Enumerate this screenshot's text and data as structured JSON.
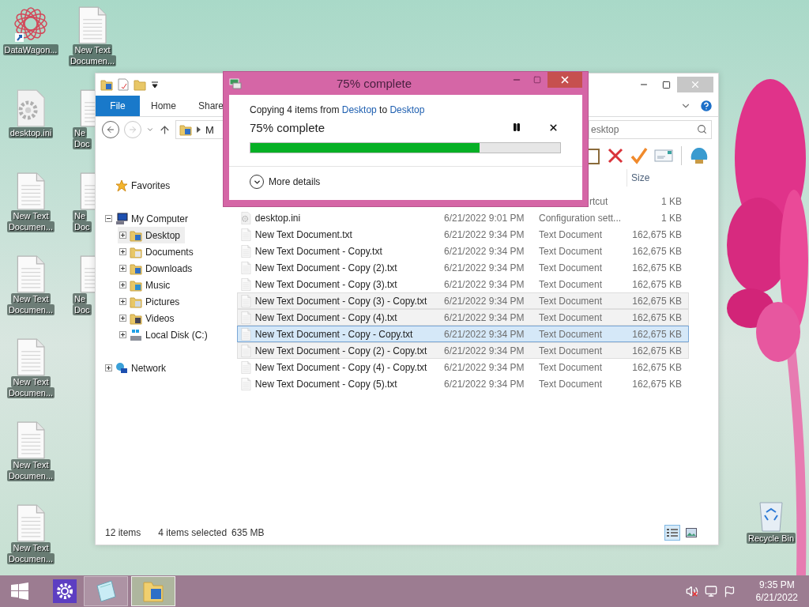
{
  "desktop": {
    "columns": [
      [
        {
          "kind": "app",
          "lines": [
            "DataWagon..."
          ]
        },
        {
          "kind": "config",
          "lines": [
            "desktop.ini"
          ]
        },
        {
          "kind": "doc",
          "lines": [
            "New Text",
            "Documen..."
          ]
        },
        {
          "kind": "doc",
          "lines": [
            "New Text",
            "Documen..."
          ]
        },
        {
          "kind": "doc",
          "lines": [
            "New Text",
            "Documen..."
          ]
        },
        {
          "kind": "doc",
          "lines": [
            "New Text",
            "Documen..."
          ]
        },
        {
          "kind": "doc",
          "lines": [
            "New Text",
            "Documen..."
          ]
        }
      ],
      [
        {
          "kind": "doc",
          "lines": [
            "New Text",
            "Documen..."
          ]
        },
        {
          "kind": "partial",
          "lines": [
            "Ne",
            "Doc"
          ]
        },
        {
          "kind": "partial",
          "lines": [
            "Ne",
            "Doc"
          ]
        },
        {
          "kind": "partial",
          "lines": [
            "Ne",
            "Doc"
          ]
        }
      ]
    ],
    "recycle_bin": {
      "label": "Recycle Bin"
    }
  },
  "explorer": {
    "ribbon_tabs": [
      {
        "label": "File",
        "selected": true
      },
      {
        "label": "Home",
        "selected": false
      },
      {
        "label": "Share",
        "selected": false
      }
    ],
    "address": {
      "path": "M"
    },
    "search": {
      "placeholder": "esktop"
    },
    "nav": [
      {
        "label": "Favorites",
        "kind": "favorites",
        "selected": false
      },
      {
        "label": "My Computer",
        "kind": "computer",
        "selected": false,
        "expanded": true,
        "children": [
          {
            "label": "Desktop",
            "kind": "desktop",
            "selected": true,
            "expanded": false
          },
          {
            "label": "Documents",
            "kind": "documents",
            "selected": false,
            "expanded": false
          },
          {
            "label": "Downloads",
            "kind": "downloads",
            "selected": false,
            "expanded": false
          },
          {
            "label": "Music",
            "kind": "music",
            "selected": false,
            "expanded": false
          },
          {
            "label": "Pictures",
            "kind": "pictures",
            "selected": false,
            "expanded": false
          },
          {
            "label": "Videos",
            "kind": "videos",
            "selected": false,
            "expanded": false
          },
          {
            "label": "Local Disk (C:)",
            "kind": "disk",
            "selected": false,
            "expanded": false
          }
        ]
      },
      {
        "label": "Network",
        "kind": "network",
        "selected": false,
        "expanded": false
      }
    ],
    "columns": [
      "Size"
    ],
    "rows": [
      {
        "kind": "partial",
        "type": "rtcut",
        "size": "1 KB",
        "selected": false,
        "focused": false
      },
      {
        "kind": "config",
        "name": "desktop.ini",
        "date": "6/21/2022 9:01 PM",
        "type": "Configuration sett...",
        "size": "1 KB",
        "selected": false,
        "focused": false
      },
      {
        "kind": "text",
        "name": "New Text Document.txt",
        "date": "6/21/2022 9:34 PM",
        "type": "Text Document",
        "size": "162,675 KB",
        "selected": false,
        "focused": false
      },
      {
        "kind": "text",
        "name": "New Text Document - Copy.txt",
        "date": "6/21/2022 9:34 PM",
        "type": "Text Document",
        "size": "162,675 KB",
        "selected": false,
        "focused": false
      },
      {
        "kind": "text",
        "name": "New Text Document - Copy (2).txt",
        "date": "6/21/2022 9:34 PM",
        "type": "Text Document",
        "size": "162,675 KB",
        "selected": false,
        "focused": false
      },
      {
        "kind": "text",
        "name": "New Text Document - Copy (3).txt",
        "date": "6/21/2022 9:34 PM",
        "type": "Text Document",
        "size": "162,675 KB",
        "selected": false,
        "focused": false
      },
      {
        "kind": "text",
        "name": "New Text Document - Copy (3) - Copy.txt",
        "date": "6/21/2022 9:34 PM",
        "type": "Text Document",
        "size": "162,675 KB",
        "selected": true,
        "focused": false
      },
      {
        "kind": "text",
        "name": "New Text Document - Copy (4).txt",
        "date": "6/21/2022 9:34 PM",
        "type": "Text Document",
        "size": "162,675 KB",
        "selected": true,
        "focused": false
      },
      {
        "kind": "text",
        "name": "New Text Document - Copy - Copy.txt",
        "date": "6/21/2022 9:34 PM",
        "type": "Text Document",
        "size": "162,675 KB",
        "selected": true,
        "focused": true
      },
      {
        "kind": "text",
        "name": "New Text Document - Copy (2) - Copy.txt",
        "date": "6/21/2022 9:34 PM",
        "type": "Text Document",
        "size": "162,675 KB",
        "selected": true,
        "focused": false
      },
      {
        "kind": "text",
        "name": "New Text Document - Copy (4) - Copy.txt",
        "date": "6/21/2022 9:34 PM",
        "type": "Text Document",
        "size": "162,675 KB",
        "selected": false,
        "focused": false
      },
      {
        "kind": "text",
        "name": "New Text Document - Copy (5).txt",
        "date": "6/21/2022 9:34 PM",
        "type": "Text Document",
        "size": "162,675 KB",
        "selected": false,
        "focused": false
      }
    ],
    "status": {
      "count": "12 items",
      "selection": "4 items selected",
      "size": "635 MB"
    },
    "view_buttons": [
      {
        "kind": "details",
        "selected": true
      },
      {
        "kind": "tiles",
        "selected": false
      }
    ]
  },
  "dialog": {
    "title": "75% complete",
    "copy_line": [
      {
        "kind": "text",
        "text": "Copying 4 items from "
      },
      {
        "kind": "link",
        "text": "Desktop"
      },
      {
        "kind": "text",
        "text": " to "
      },
      {
        "kind": "link",
        "text": "Desktop"
      }
    ],
    "heading": "75% complete",
    "progress": {
      "level": 0.74
    },
    "more_details": "More details"
  },
  "taskbar": {
    "apps": [
      {
        "kind": "settings",
        "selected": false
      },
      {
        "kind": "notepad",
        "selected": false
      },
      {
        "kind": "explorer",
        "selected": true
      }
    ],
    "tray": {
      "muted": true,
      "time": "9:35 PM",
      "date": "6/21/2022"
    }
  }
}
